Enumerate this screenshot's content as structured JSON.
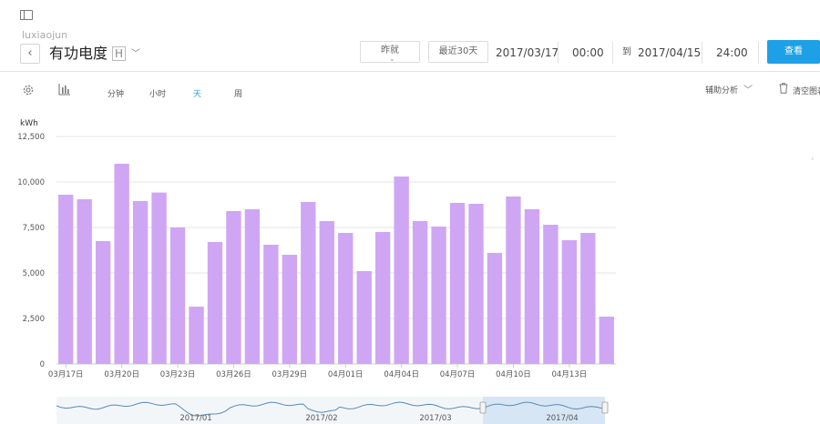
{
  "header": {
    "username": "luxiaojun",
    "title": "有功电度",
    "unit_tag": "H",
    "back_glyph": "‹",
    "chevron_glyph": "﹀"
  },
  "date_range": {
    "preset_label": "昨就",
    "last30_label": "最近30天",
    "start_date": "2017/03/17",
    "start_time": "00:00",
    "to_label": "到",
    "end_date": "2017/04/15",
    "end_time": "24:00",
    "query_label": "查看"
  },
  "toolbar": {
    "granularity": [
      "分钟",
      "小时",
      "天",
      "周"
    ],
    "active_granularity": "天",
    "assist_label": "辅助分析",
    "assist_chevron": "﹀",
    "clear_label": "清空图表",
    "right_arrow": "‹"
  },
  "colors": {
    "accent": "#1ea0e6",
    "bar": "#cfa6f3",
    "grid": "#e4e4e4",
    "navigator_selection": "#cfe2f3",
    "navigator_line": "#5a8ab5"
  },
  "chart_data": {
    "type": "bar",
    "ylabel": "kWh",
    "ylim": [
      0,
      12500
    ],
    "yticks": [
      "0",
      "2,500",
      "5,000",
      "7,500",
      "10,000",
      "12,500"
    ],
    "ytick_values": [
      0,
      2500,
      5000,
      7500,
      10000,
      12500
    ],
    "grid": true,
    "categories": [
      "03月17日",
      "03月18日",
      "03月19日",
      "03月20日",
      "03月21日",
      "03月22日",
      "03月23日",
      "03月24日",
      "03月25日",
      "03月26日",
      "03月27日",
      "03月28日",
      "03月29日",
      "03月30日",
      "03月31日",
      "04月01日",
      "04月02日",
      "04月03日",
      "04月04日",
      "04月05日",
      "04月06日",
      "04月07日",
      "04月08日",
      "04月09日",
      "04月10日",
      "04月11日",
      "04月12日",
      "04月13日",
      "04月14日",
      "04月15日"
    ],
    "tick_labels": [
      "03月17日",
      "03月20日",
      "03月23日",
      "03月26日",
      "03月29日",
      "04月01日",
      "04月04日",
      "04月07日",
      "04月10日",
      "04月13日"
    ],
    "values": [
      9300,
      9050,
      6750,
      11000,
      8950,
      9420,
      7500,
      3150,
      6700,
      8400,
      8500,
      6550,
      6000,
      8900,
      7850,
      7200,
      5100,
      7250,
      10300,
      7850,
      7550,
      8850,
      8800,
      6100,
      9200,
      8500,
      7650,
      6800,
      7200,
      2600
    ]
  },
  "navigator": {
    "labels": [
      "2017/01",
      "2017/02",
      "2017/03",
      "2017/04"
    ]
  }
}
